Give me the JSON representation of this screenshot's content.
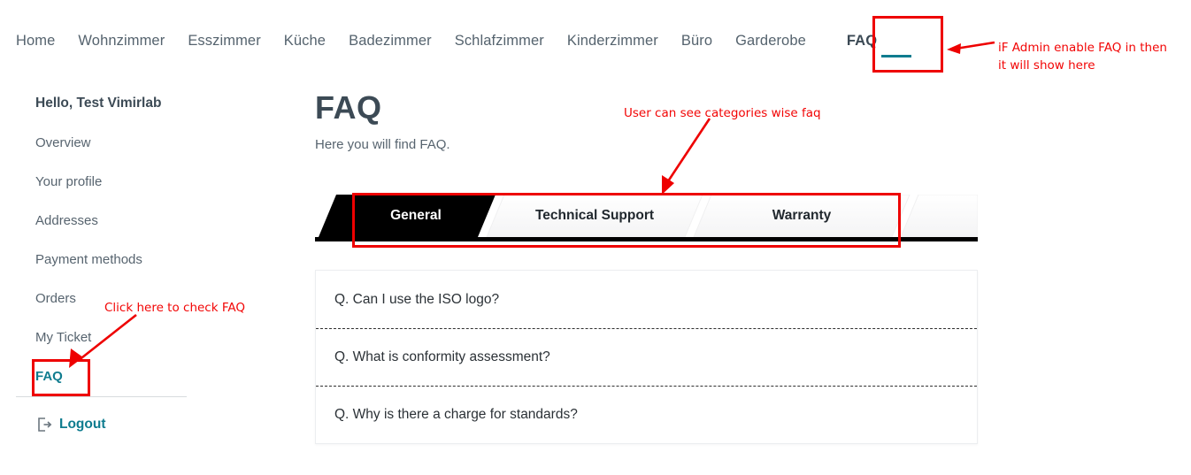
{
  "topnav": {
    "items": [
      {
        "label": "Home",
        "active": false
      },
      {
        "label": "Wohnzimmer",
        "active": false
      },
      {
        "label": "Esszimmer",
        "active": false
      },
      {
        "label": "Küche",
        "active": false
      },
      {
        "label": "Badezimmer",
        "active": false
      },
      {
        "label": "Schlafzimmer",
        "active": false
      },
      {
        "label": "Kinderzimmer",
        "active": false
      },
      {
        "label": "Büro",
        "active": false
      },
      {
        "label": "Garderobe",
        "active": false
      },
      {
        "label": "FAQ",
        "active": true
      }
    ]
  },
  "sidebar": {
    "greeting": "Hello, Test Vimirlab",
    "items": [
      {
        "label": "Overview"
      },
      {
        "label": "Your profile"
      },
      {
        "label": "Addresses"
      },
      {
        "label": "Payment methods"
      },
      {
        "label": "Orders"
      },
      {
        "label": "My Ticket"
      },
      {
        "label": "FAQ"
      }
    ],
    "logout": {
      "label": "Logout",
      "icon": "logout-icon"
    }
  },
  "main": {
    "title": "FAQ",
    "subtitle": "Here you will find FAQ.",
    "tabs": [
      {
        "label": "General",
        "active": true
      },
      {
        "label": "Technical Support",
        "active": false
      },
      {
        "label": "Warranty",
        "active": false
      }
    ],
    "faqs": [
      {
        "question": "Q. Can I use the ISO logo?"
      },
      {
        "question": "Q. What is conformity assessment?"
      },
      {
        "question": "Q. Why is there a charge for standards?"
      }
    ]
  },
  "annotations": [
    {
      "id": "nav-faq-note",
      "text": "iF Admin enable FAQ in then\nit will show here"
    },
    {
      "id": "tabs-note",
      "text": "User can see categories wise faq"
    },
    {
      "id": "sidebar-faq-note",
      "text": "Click here to check FAQ"
    }
  ],
  "colors": {
    "accent_teal": "#0f7c8f",
    "annotation_red": "#ee0000",
    "text_dark": "#3c4a55",
    "text_muted": "#57646f",
    "tab_active_bg": "#000000"
  }
}
